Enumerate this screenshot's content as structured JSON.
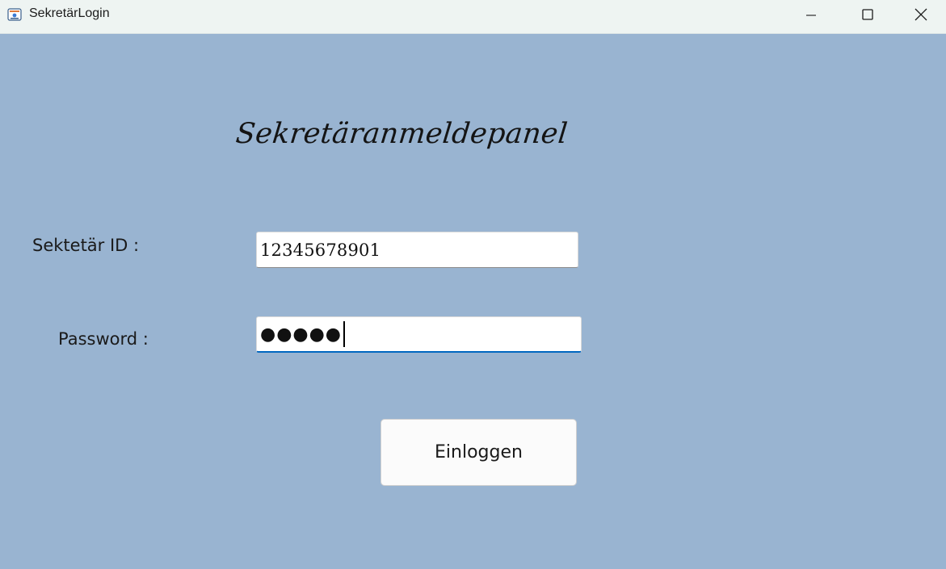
{
  "window": {
    "title": "SekretärLogin",
    "app_icon": "app-icon",
    "controls": {
      "minimize_icon": "minimize-icon",
      "maximize_icon": "maximize-icon",
      "close_icon": "close-icon"
    }
  },
  "form": {
    "heading": "Sekretäranmeldepanel",
    "id_label": "Sektetär ID :",
    "id_value": "12345678901",
    "password_label": "Password :",
    "password_value": "●●●●●",
    "submit_label": "Einloggen"
  },
  "colors": {
    "background": "#99b4d1",
    "titlebar": "#eef4f2",
    "focus_accent": "#0067c0"
  }
}
